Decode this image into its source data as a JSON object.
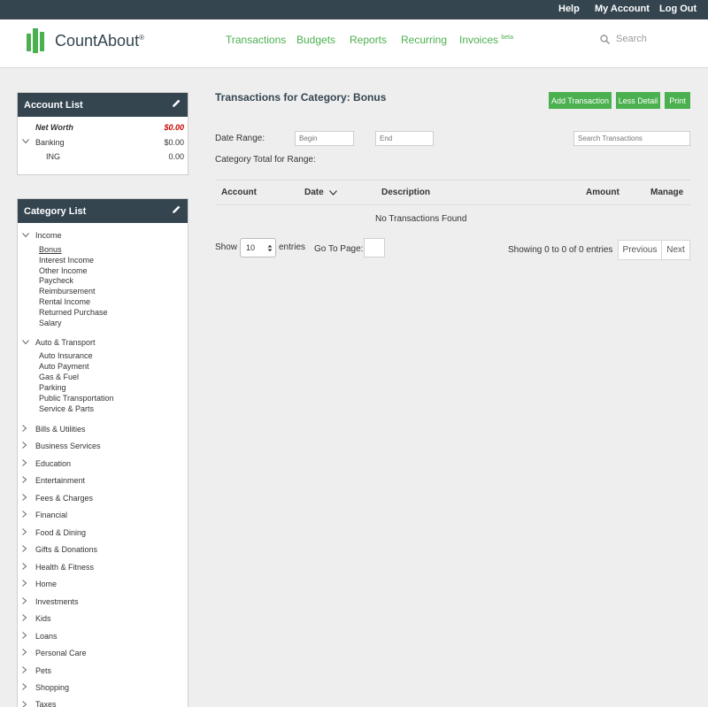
{
  "topbar": {
    "help": "Help",
    "my_account": "My Account",
    "log_out": "Log Out"
  },
  "brand": {
    "name": "CountAbout",
    "mark": "®"
  },
  "nav": {
    "transactions": "Transactions",
    "budgets": "Budgets",
    "reports": "Reports",
    "recurring": "Recurring",
    "invoices": "Invoices",
    "invoices_sup": "beta"
  },
  "search": {
    "label": "Search"
  },
  "account_list": {
    "title": "Account List",
    "net_worth_label": "Net Worth",
    "net_worth_value": "$0.00",
    "banking_label": "Banking",
    "banking_value": "$0.00",
    "ing_label": "ING",
    "ing_value": "0.00"
  },
  "category_list": {
    "title": "Category List",
    "income": {
      "label": "Income",
      "children": [
        "Bonus",
        "Interest Income",
        "Other Income",
        "Paycheck",
        "Reimbursement",
        "Rental Income",
        "Returned Purchase",
        "Salary"
      ]
    },
    "auto": {
      "label": "Auto & Transport",
      "children": [
        "Auto Insurance",
        "Auto Payment",
        "Gas & Fuel",
        "Parking",
        "Public Transportation",
        "Service & Parts"
      ]
    },
    "collapsed": [
      "Bills & Utilities",
      "Business Services",
      "Education",
      "Entertainment",
      "Fees & Charges",
      "Financial",
      "Food & Dining",
      "Gifts & Donations",
      "Health & Fitness",
      "Home",
      "Investments",
      "Kids",
      "Loans",
      "Personal Care",
      "Pets",
      "Shopping",
      "Taxes"
    ]
  },
  "main": {
    "title": "Transactions for Category: Bonus",
    "add_transaction": "Add Transaction",
    "less_detail": "Less Detail",
    "print": "Print",
    "date_range_label": "Date Range:",
    "begin_placeholder": "Begin",
    "end_placeholder": "End",
    "search_placeholder": "Search Transactions",
    "category_total_label": "Category Total for Range:",
    "columns": {
      "account": "Account",
      "date": "Date",
      "description": "Description",
      "amount": "Amount",
      "manage": "Manage"
    },
    "empty_message": "No Transactions Found",
    "show_label": "Show",
    "page_size": "10",
    "entries_label": "entries",
    "go_to_page_label": "Go To Page:",
    "showing_text": "Showing 0 to 0 of 0 entries",
    "previous": "Previous",
    "next": "Next"
  },
  "colors": {
    "accent": "#4bb04f",
    "dark": "#344550",
    "negative": "#cc0000"
  }
}
